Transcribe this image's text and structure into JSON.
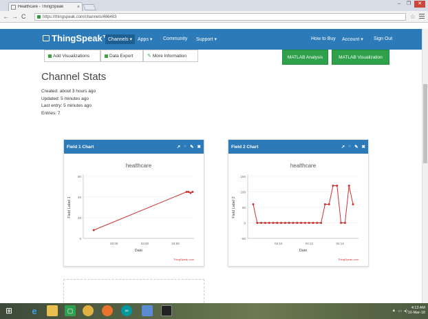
{
  "browser": {
    "tab_title": "Healthcare - ThingSpeak",
    "tab_close": "×",
    "url": "https://thingspeak.com/channels/466483",
    "window_buttons": [
      "–",
      "❐",
      "✕"
    ],
    "nav": {
      "back": "←",
      "forward": "→",
      "reload": "C",
      "star": "☆"
    }
  },
  "nav": {
    "logo": "ThingSpeak™",
    "items": [
      "Channels ▾",
      "Apps ▾",
      "Community",
      "Support ▾"
    ],
    "right_items": [
      "How to Buy",
      "Account ▾",
      "Sign Out"
    ]
  },
  "toolbar": {
    "add_visualizations": "Add Visualizations",
    "data_export": "Data Export",
    "more_information": "More Information",
    "matlab_analysis": "MATLAB Analysis",
    "matlab_visualization": "MATLAB Visualization"
  },
  "stats": {
    "title": "Channel Stats",
    "created": "Created:  about 3 hours ago",
    "updated": "Updated:  5 minutes ago",
    "last_entry": "Last entry:  5 minutes ago",
    "entries": "Entries: 7"
  },
  "panels": [
    {
      "header": "Field 1 Chart",
      "icons": [
        "↗",
        "○",
        "✎",
        "✖"
      ]
    },
    {
      "header": "Field 2 Chart",
      "icons": [
        "↗",
        "○",
        "✎",
        "✖"
      ]
    }
  ],
  "chart_data": [
    {
      "type": "line",
      "title": "healthcare",
      "xlabel": "Date",
      "ylabel": "Field Label 1",
      "x_ticks": [
        "02:00",
        "03:00",
        "04:00"
      ],
      "y_ticks": [
        "0",
        "20",
        "40",
        "60"
      ],
      "ylim": [
        0,
        60
      ],
      "credit": "ThingSpeak.com",
      "color": "#d12f2f",
      "points": [
        [
          0.05,
          8
        ],
        [
          0.98,
          45
        ],
        [
          1.0,
          45
        ],
        [
          1.02,
          44
        ],
        [
          1.04,
          45
        ]
      ]
    },
    {
      "type": "line",
      "title": "healthcare",
      "xlabel": "Date",
      "ylabel": "Field Label 2",
      "x_ticks": [
        "04:10",
        "04:12",
        "04:14"
      ],
      "y_ticks": [
        "-50",
        "0",
        "50",
        "100",
        "150"
      ],
      "ylim": [
        -50,
        150
      ],
      "credit": "ThingSpeak.com",
      "color": "#d12f2f",
      "points": [
        [
          0.0,
          60
        ],
        [
          0.04,
          0
        ],
        [
          0.08,
          0
        ],
        [
          0.12,
          0
        ],
        [
          0.16,
          0
        ],
        [
          0.2,
          0
        ],
        [
          0.24,
          0
        ],
        [
          0.28,
          0
        ],
        [
          0.32,
          0
        ],
        [
          0.36,
          0
        ],
        [
          0.4,
          0
        ],
        [
          0.44,
          0
        ],
        [
          0.48,
          0
        ],
        [
          0.52,
          0
        ],
        [
          0.56,
          0
        ],
        [
          0.6,
          0
        ],
        [
          0.64,
          0
        ],
        [
          0.68,
          0
        ],
        [
          0.72,
          60
        ],
        [
          0.76,
          60
        ],
        [
          0.8,
          120
        ],
        [
          0.84,
          120
        ],
        [
          0.88,
          0
        ],
        [
          0.92,
          0
        ],
        [
          0.96,
          120
        ],
        [
          1.0,
          60
        ]
      ]
    }
  ],
  "taskbar": {
    "clock_time": "4:13 AM",
    "clock_date": "10-Mar-18"
  }
}
